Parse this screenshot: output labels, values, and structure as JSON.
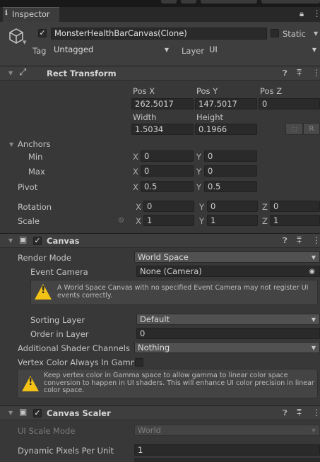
{
  "inspector": {
    "tab_label": "Inspector",
    "lock_icon": "lock-icon",
    "menu_icon": "kebab-icon"
  },
  "gameobject": {
    "name": "MonsterHealthBarCanvas(Clone)",
    "active": true,
    "static_label": "Static",
    "tag_label": "Tag",
    "tag_value": "Untagged",
    "layer_label": "Layer",
    "layer_value": "UI"
  },
  "rect_transform": {
    "title": "Rect Transform",
    "pos_x_label": "Pos X",
    "pos_y_label": "Pos Y",
    "pos_z_label": "Pos Z",
    "pos_x": "262.5017",
    "pos_y": "147.5017",
    "pos_z": "0",
    "width_label": "Width",
    "height_label": "Height",
    "width": "1.5034",
    "height": "0.1966",
    "r_button": "R",
    "anchors_label": "Anchors",
    "min_label": "Min",
    "max_label": "Max",
    "min_x": "0",
    "min_y": "0",
    "max_x": "0",
    "max_y": "0",
    "pivot_label": "Pivot",
    "pivot_x": "0.5",
    "pivot_y": "0.5",
    "rotation_label": "Rotation",
    "rot_x": "0",
    "rot_y": "0",
    "rot_z": "0",
    "scale_label": "Scale",
    "scale_x": "1",
    "scale_y": "1",
    "scale_z": "1",
    "x": "X",
    "y": "Y",
    "z": "Z"
  },
  "canvas": {
    "title": "Canvas",
    "render_mode_label": "Render Mode",
    "render_mode": "World Space",
    "event_camera_label": "Event Camera",
    "event_camera": "None (Camera)",
    "warning": "A World Space Canvas with no specified Event Camera may not register UI events correctly.",
    "sorting_layer_label": "Sorting Layer",
    "sorting_layer": "Default",
    "order_label": "Order in Layer",
    "order": "0",
    "shader_channels_label": "Additional Shader Channels",
    "shader_channels": "Nothing",
    "vertex_color_label": "Vertex Color Always In Gamm",
    "vertex_info": "Keep vertex color in Gamma space to allow gamma to linear color space conversion to happen in UI shaders. This will enhance UI color precision in linear color space."
  },
  "canvas_scaler": {
    "title": "Canvas Scaler",
    "ui_scale_mode_label": "UI Scale Mode",
    "ui_scale_mode": "World",
    "dpp_label": "Dynamic Pixels Per Unit",
    "dpp": "1"
  },
  "colors": {
    "bg": "#383838",
    "header": "#3e3e3e",
    "warning": "#f3c215"
  }
}
